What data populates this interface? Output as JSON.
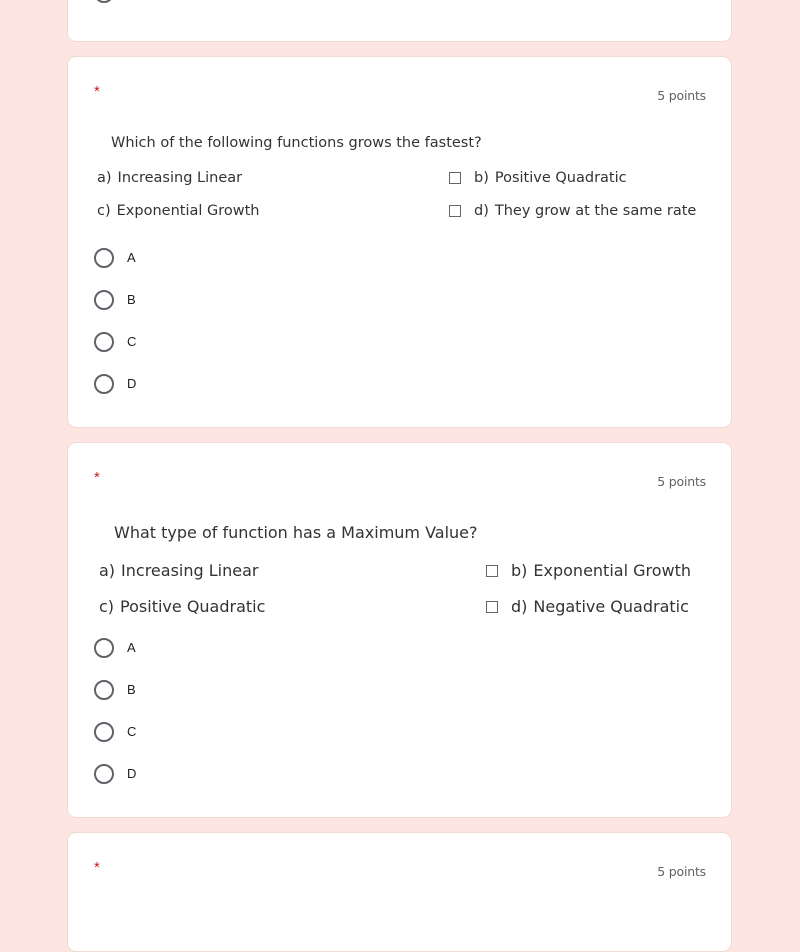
{
  "colors": {
    "page_background": "#fde6e1",
    "card_background": "#ffffff",
    "required_asterisk": "#c5221f",
    "points_text": "#5f6368"
  },
  "questions": [
    {
      "required_marker": "*",
      "points": "5 points",
      "image_text": {
        "title": "Which of the following functions grows the fastest?",
        "options": {
          "a": {
            "letter": "a)",
            "text": "Increasing Linear"
          },
          "b": {
            "letter": "b)",
            "text": "Positive Quadratic"
          },
          "c": {
            "letter": "c)",
            "text": "Exponential Growth"
          },
          "d": {
            "letter": "d)",
            "text": "They grow at the same rate"
          }
        }
      },
      "choices": [
        "A",
        "B",
        "C",
        "D"
      ]
    },
    {
      "required_marker": "*",
      "points": "5 points",
      "image_text": {
        "title": "What type of function has a Maximum Value?",
        "options": {
          "a": {
            "letter": "a)",
            "text": "Increasing Linear"
          },
          "b": {
            "letter": "b)",
            "text": "Exponential Growth"
          },
          "c": {
            "letter": "c)",
            "text": "Positive Quadratic"
          },
          "d": {
            "letter": "d)",
            "text": "Negative Quadratic"
          }
        }
      },
      "choices": [
        "A",
        "B",
        "C",
        "D"
      ]
    },
    {
      "required_marker": "*",
      "points": "5 points"
    }
  ]
}
